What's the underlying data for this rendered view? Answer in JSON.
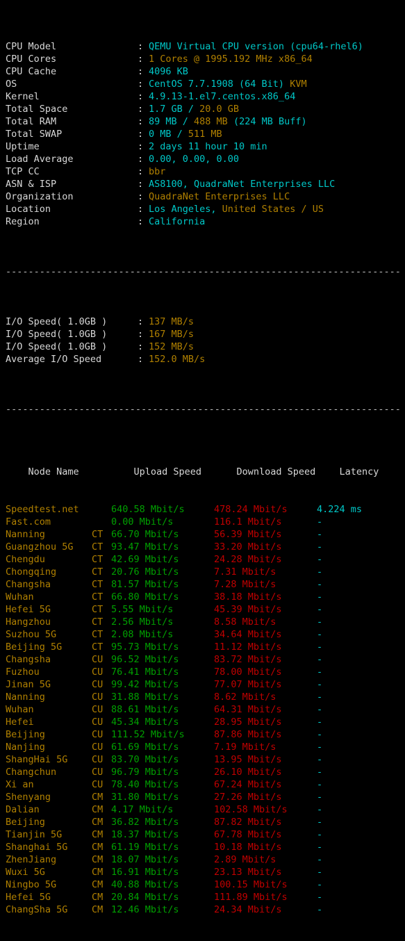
{
  "theme": {
    "background": "#000000",
    "label": "#d8d8d8",
    "cyan": "#00c8c8",
    "yellow": "#b08000",
    "green": "#00a000",
    "red": "#c00000",
    "separator": "#bcbcbc"
  },
  "system_info": {
    "colon": ":",
    "rows": [
      {
        "label": "CPU Model",
        "value_cyan": "QEMU Virtual CPU version (cpu64-rhel6)",
        "value_yellow": ""
      },
      {
        "label": "CPU Cores",
        "value_cyan": "",
        "value_yellow": "1 Cores @ 1995.192 MHz x86_64"
      },
      {
        "label": "CPU Cache",
        "value_cyan": "4096 KB",
        "value_yellow": ""
      },
      {
        "label": "OS",
        "value_cyan": "CentOS 7.7.1908 (64 Bit) ",
        "value_yellow": "KVM"
      },
      {
        "label": "Kernel",
        "value_cyan": "4.9.13-1.el7.centos.x86_64",
        "value_yellow": ""
      },
      {
        "label": "Total Space",
        "value_cyan": "1.7 GB / ",
        "value_yellow": "20.0 GB"
      },
      {
        "label": "Total RAM",
        "value_cyan": "89 MB / ",
        "value_yellow": "488 MB",
        "value_cyan2": " (224 MB Buff)"
      },
      {
        "label": "Total SWAP",
        "value_cyan": "0 MB / ",
        "value_yellow": "511 MB"
      },
      {
        "label": "Uptime",
        "value_cyan": "2 days 11 hour 10 min",
        "value_yellow": ""
      },
      {
        "label": "Load Average",
        "value_cyan": "0.00, 0.00, 0.00",
        "value_yellow": ""
      },
      {
        "label": "TCP CC",
        "value_cyan": "",
        "value_yellow": "bbr"
      },
      {
        "label": "ASN & ISP",
        "value_cyan": "AS8100, QuadraNet Enterprises LLC",
        "value_yellow": ""
      },
      {
        "label": "Organization",
        "value_cyan": "",
        "value_yellow": "QuadraNet Enterprises LLC"
      },
      {
        "label": "Location",
        "value_cyan": "Los Angeles, ",
        "value_yellow": "United States / US"
      },
      {
        "label": "Region",
        "value_cyan": "California",
        "value_yellow": ""
      }
    ]
  },
  "separator_line": "----------------------------------------------------------------------",
  "io_speed": {
    "colon": ":",
    "rows": [
      {
        "label": "I/O Speed( 1.0GB )",
        "value": "137 MB/s"
      },
      {
        "label": "I/O Speed( 1.0GB )",
        "value": "167 MB/s"
      },
      {
        "label": "I/O Speed( 1.0GB )",
        "value": "152 MB/s"
      },
      {
        "label": "Average I/O Speed",
        "value": "152.0 MB/s"
      }
    ]
  },
  "speedtest": {
    "headers": {
      "node": "Node Name",
      "upload": "Upload Speed",
      "download": "Download Speed",
      "latency": "Latency"
    },
    "rows": [
      {
        "node": "Speedtest.net",
        "op": "",
        "upload": "640.58 Mbit/s",
        "download": "478.24 Mbit/s",
        "latency": "4.224 ms"
      },
      {
        "node": "Fast.com",
        "op": "",
        "upload": "0.00 Mbit/s",
        "download": "116.1 Mbit/s",
        "latency": "-"
      },
      {
        "node": "Nanning",
        "op": "CT",
        "upload": "66.70 Mbit/s",
        "download": "56.39 Mbit/s",
        "latency": "-"
      },
      {
        "node": "Guangzhou 5G",
        "op": "CT",
        "upload": "93.47 Mbit/s",
        "download": "33.20 Mbit/s",
        "latency": "-"
      },
      {
        "node": "Chengdu",
        "op": "CT",
        "upload": "42.69 Mbit/s",
        "download": "24.28 Mbit/s",
        "latency": "-"
      },
      {
        "node": "Chongqing",
        "op": "CT",
        "upload": "20.76 Mbit/s",
        "download": "7.31 Mbit/s",
        "latency": "-"
      },
      {
        "node": "Changsha",
        "op": "CT",
        "upload": "81.57 Mbit/s",
        "download": "7.28 Mbit/s",
        "latency": "-"
      },
      {
        "node": "Wuhan",
        "op": "CT",
        "upload": "66.80 Mbit/s",
        "download": "38.18 Mbit/s",
        "latency": "-"
      },
      {
        "node": "Hefei 5G",
        "op": "CT",
        "upload": "5.55 Mbit/s",
        "download": "45.39 Mbit/s",
        "latency": "-"
      },
      {
        "node": "Hangzhou",
        "op": "CT",
        "upload": "2.56 Mbit/s",
        "download": "8.58 Mbit/s",
        "latency": "-"
      },
      {
        "node": "Suzhou 5G",
        "op": "CT",
        "upload": "2.08 Mbit/s",
        "download": "34.64 Mbit/s",
        "latency": "-"
      },
      {
        "node": "Beijing 5G",
        "op": "CT",
        "upload": "95.73 Mbit/s",
        "download": "11.12 Mbit/s",
        "latency": "-"
      },
      {
        "node": "Changsha",
        "op": "CU",
        "upload": "96.52 Mbit/s",
        "download": "83.72 Mbit/s",
        "latency": "-"
      },
      {
        "node": "Fuzhou",
        "op": "CU",
        "upload": "76.41 Mbit/s",
        "download": "78.00 Mbit/s",
        "latency": "-"
      },
      {
        "node": "Jinan 5G",
        "op": "CU",
        "upload": "99.42 Mbit/s",
        "download": "77.07 Mbit/s",
        "latency": "-"
      },
      {
        "node": "Nanning",
        "op": "CU",
        "upload": "31.88 Mbit/s",
        "download": "8.62 Mbit/s",
        "latency": "-"
      },
      {
        "node": "Wuhan",
        "op": "CU",
        "upload": "88.61 Mbit/s",
        "download": "64.31 Mbit/s",
        "latency": "-"
      },
      {
        "node": "Hefei",
        "op": "CU",
        "upload": "45.34 Mbit/s",
        "download": "28.95 Mbit/s",
        "latency": "-"
      },
      {
        "node": "Beijing",
        "op": "CU",
        "upload": "111.52 Mbit/s",
        "download": "87.86 Mbit/s",
        "latency": "-"
      },
      {
        "node": "Nanjing",
        "op": "CU",
        "upload": "61.69 Mbit/s",
        "download": "7.19 Mbit/s",
        "latency": "-"
      },
      {
        "node": "ShangHai 5G",
        "op": "CU",
        "upload": "83.70 Mbit/s",
        "download": "13.95 Mbit/s",
        "latency": "-"
      },
      {
        "node": "Changchun",
        "op": "CU",
        "upload": "96.79 Mbit/s",
        "download": "26.10 Mbit/s",
        "latency": "-"
      },
      {
        "node": "Xi an",
        "op": "CU",
        "upload": "78.40 Mbit/s",
        "download": "67.24 Mbit/s",
        "latency": "-"
      },
      {
        "node": "Shenyang",
        "op": "CM",
        "upload": "31.80 Mbit/s",
        "download": "27.26 Mbit/s",
        "latency": "-"
      },
      {
        "node": "Dalian",
        "op": "CM",
        "upload": "4.17 Mbit/s",
        "download": "102.58 Mbit/s",
        "latency": "-"
      },
      {
        "node": "Beijing",
        "op": "CM",
        "upload": "36.82 Mbit/s",
        "download": "87.82 Mbit/s",
        "latency": "-"
      },
      {
        "node": "Tianjin 5G",
        "op": "CM",
        "upload": "18.37 Mbit/s",
        "download": "67.78 Mbit/s",
        "latency": "-"
      },
      {
        "node": "Shanghai 5G",
        "op": "CM",
        "upload": "61.19 Mbit/s",
        "download": "10.18 Mbit/s",
        "latency": "-"
      },
      {
        "node": "ZhenJiang",
        "op": "CM",
        "upload": "18.07 Mbit/s",
        "download": "2.89 Mbit/s",
        "latency": "-"
      },
      {
        "node": "Wuxi 5G",
        "op": "CM",
        "upload": "16.91 Mbit/s",
        "download": "23.13 Mbit/s",
        "latency": "-"
      },
      {
        "node": "Ningbo 5G",
        "op": "CM",
        "upload": "40.88 Mbit/s",
        "download": "100.15 Mbit/s",
        "latency": "-"
      },
      {
        "node": "Hefei 5G",
        "op": "CM",
        "upload": "20.84 Mbit/s",
        "download": "111.89 Mbit/s",
        "latency": "-"
      },
      {
        "node": "ChangSha 5G",
        "op": "CM",
        "upload": "12.46 Mbit/s",
        "download": "24.34 Mbit/s",
        "latency": "-"
      }
    ]
  }
}
